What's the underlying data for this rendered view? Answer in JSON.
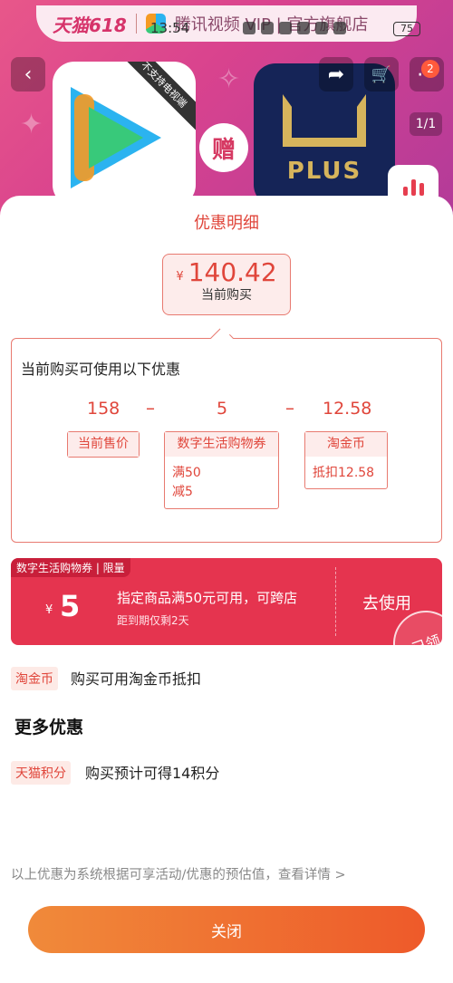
{
  "banner": {
    "brand": "天猫618",
    "text": "腾讯视频 VIP | 官方旗舰店"
  },
  "status_bar": {
    "time": "13:54",
    "battery": "75"
  },
  "product": {
    "ribbon": "不支持电视端",
    "gift": "赠",
    "plus_label": "PLUS",
    "pager": "1/1",
    "notif_count": "2"
  },
  "sheet": {
    "title": "优惠明细",
    "price": {
      "currency": "¥",
      "value": "140.42",
      "label": "当前购买"
    },
    "calc": {
      "title": "当前购买可使用以下优惠",
      "original": {
        "value": "158",
        "label": "当前售价"
      },
      "minus1": "–",
      "coupon": {
        "value": "5",
        "label": "数字生活购物券",
        "detail1": "满50",
        "detail2": "减5"
      },
      "minus2": "–",
      "coins": {
        "value": "12.58",
        "label": "淘金币",
        "detail": "抵扣12.58"
      }
    },
    "coupon_card": {
      "tag": "数字生活购物券 | 限量",
      "currency": "¥",
      "amount": "5",
      "desc": "指定商品满50元可用，可跨店",
      "expiry": "距到期仅剩2天",
      "action": "去使用",
      "stamp": "已领"
    },
    "taojinbi": {
      "pill": "淘金币",
      "text": "购买可用淘金币抵扣"
    },
    "more_title": "更多优惠",
    "points": {
      "pill": "天猫积分",
      "text": "购买预计可得14积分"
    },
    "footnote": "以上优惠为系统根据可享活动/优惠的预估值，查看详情 >",
    "close_label": "关闭"
  },
  "colors": {
    "accent": "#e0463b",
    "coupon_bg": "#e5344f",
    "close_start": "#f08a3a",
    "close_end": "#ee5a2a"
  }
}
